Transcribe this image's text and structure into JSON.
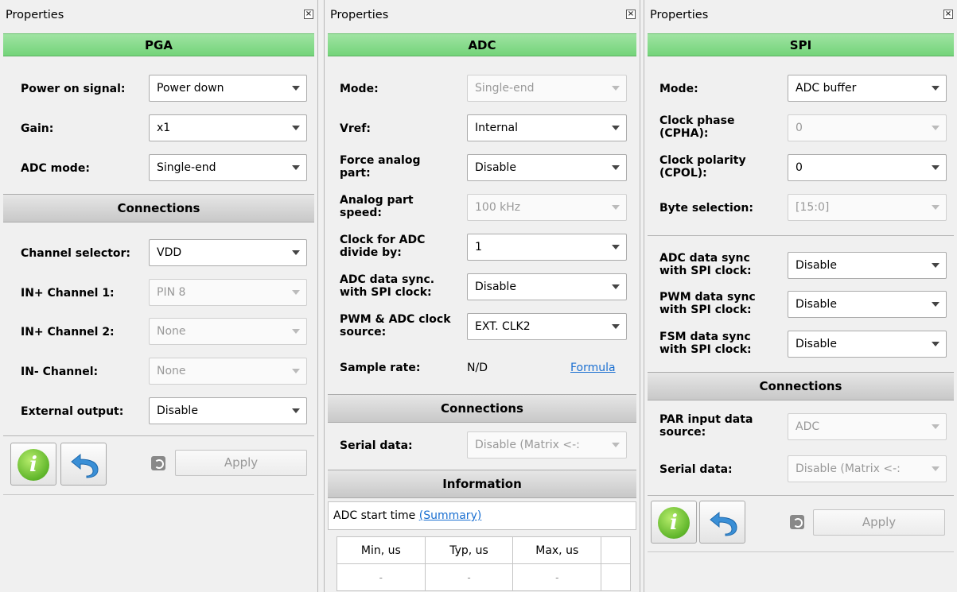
{
  "panels": {
    "pga": {
      "title": "Properties",
      "header": "PGA",
      "fields": [
        {
          "label": "Power on signal:",
          "value": "Power down",
          "disabled": false
        },
        {
          "label": "Gain:",
          "value": "x1",
          "disabled": false
        },
        {
          "label": "ADC mode:",
          "value": "Single-end",
          "disabled": false
        }
      ],
      "connections_header": "Connections",
      "connections": [
        {
          "label": "Channel selector:",
          "value": "VDD",
          "disabled": false
        },
        {
          "label": "IN+ Channel 1:",
          "value": "PIN 8",
          "disabled": true
        },
        {
          "label": "IN+ Channel 2:",
          "value": "None",
          "disabled": true
        },
        {
          "label": "IN- Channel:",
          "value": "None",
          "disabled": true
        },
        {
          "label": "External output:",
          "value": "Disable",
          "disabled": false
        }
      ],
      "info_glyph": "i",
      "apply_label": "Apply"
    },
    "adc": {
      "title": "Properties",
      "header": "ADC",
      "fields": [
        {
          "label": "Mode:",
          "value": "Single-end",
          "disabled": true
        },
        {
          "label": "Vref:",
          "value": "Internal",
          "disabled": false
        },
        {
          "label": "Force analog part:",
          "value": "Disable",
          "disabled": false
        },
        {
          "label": "Analog part speed:",
          "value": "100 kHz",
          "disabled": true
        },
        {
          "label": "Clock for ADC divide by:",
          "value": "1",
          "disabled": false
        },
        {
          "label": "ADC data sync. with SPI clock:",
          "value": "Disable",
          "disabled": false
        },
        {
          "label": "PWM & ADC clock source:",
          "value": "EXT. CLK2",
          "disabled": false
        }
      ],
      "sample_rate_label": "Sample rate:",
      "sample_rate_value": "N/D",
      "formula_link": "Formula",
      "connections_header": "Connections",
      "serial_data_label": "Serial data:",
      "serial_data_value": "Disable (Matrix <-:",
      "information_header": "Information",
      "adc_start_time_label": "ADC start time",
      "summary_link": "(Summary)",
      "table": {
        "headers": [
          "Min, us",
          "Typ, us",
          "Max, us",
          ""
        ],
        "values": [
          "-",
          "-",
          "-",
          ""
        ]
      }
    },
    "spi": {
      "title": "Properties",
      "header": "SPI",
      "fields": [
        {
          "label": "Mode:",
          "value": "ADC buffer",
          "disabled": false
        },
        {
          "label": "Clock phase (CPHA):",
          "value": "0",
          "disabled": true
        },
        {
          "label": "Clock polarity (CPOL):",
          "value": "0",
          "disabled": false
        },
        {
          "label": "Byte selection:",
          "value": "[15:0]",
          "disabled": true
        }
      ],
      "sync_fields": [
        {
          "label": "ADC data sync with SPI clock:",
          "value": "Disable",
          "disabled": false
        },
        {
          "label": "PWM data sync with SPI clock:",
          "value": "Disable",
          "disabled": false
        },
        {
          "label": "FSM data sync with SPI clock:",
          "value": "Disable",
          "disabled": false
        }
      ],
      "connections_header": "Connections",
      "connections": [
        {
          "label": "PAR input data source:",
          "value": "ADC",
          "disabled": true
        },
        {
          "label": "Serial data:",
          "value": "Disable (Matrix <-:",
          "disabled": true
        }
      ],
      "info_glyph": "i",
      "apply_label": "Apply"
    }
  },
  "colors": {
    "header_green": "#7fd884",
    "section_gray": "#d4d4d4",
    "link_blue": "#1a6fd1",
    "info_green": "#5fb52a",
    "undo_blue": "#3a8fd6"
  },
  "icons": {
    "close": "close-icon",
    "info": "info-icon",
    "undo": "undo-icon",
    "revert": "revert-icon",
    "dropdown": "chevron-down-icon"
  }
}
